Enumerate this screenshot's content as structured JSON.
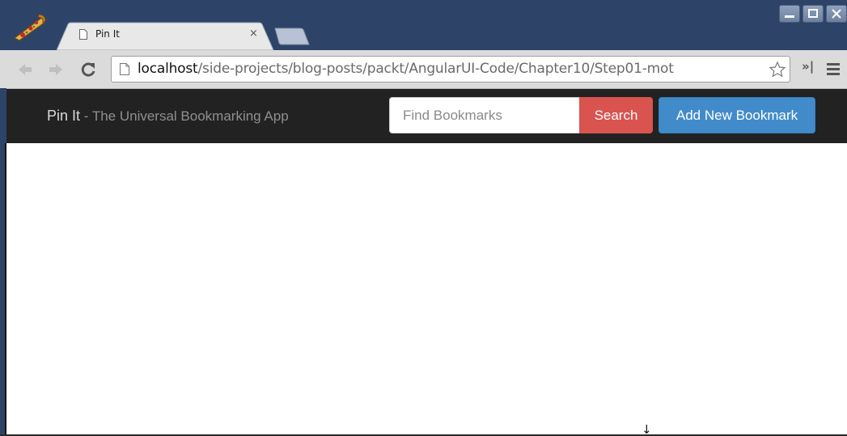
{
  "browser": {
    "tab": {
      "title": "Pin It",
      "close_glyph": "×"
    },
    "window_controls": [
      "minimize",
      "maximize",
      "close"
    ],
    "toolbar": {
      "back_icon": "back-arrow-icon",
      "forward_icon": "forward-arrow-icon",
      "reload_icon": "reload-icon",
      "url_host": "localhost",
      "url_path": "/side-projects/blog-posts/packt/AngularUI-Code/Chapter10/Step01-mot",
      "more_glyph": "»|",
      "menu_icon": "hamburger-menu-icon"
    }
  },
  "page": {
    "navbar": {
      "brand_name": "Pin It",
      "brand_tagline": " - The Universal Bookmarking App",
      "search_placeholder": "Find Bookmarks",
      "search_label": "Search",
      "add_label": "Add New Bookmark"
    }
  },
  "colors": {
    "titlebar": "#2d4468",
    "navbar": "#222222",
    "search_button": "#d9534f",
    "add_button": "#428bca"
  }
}
